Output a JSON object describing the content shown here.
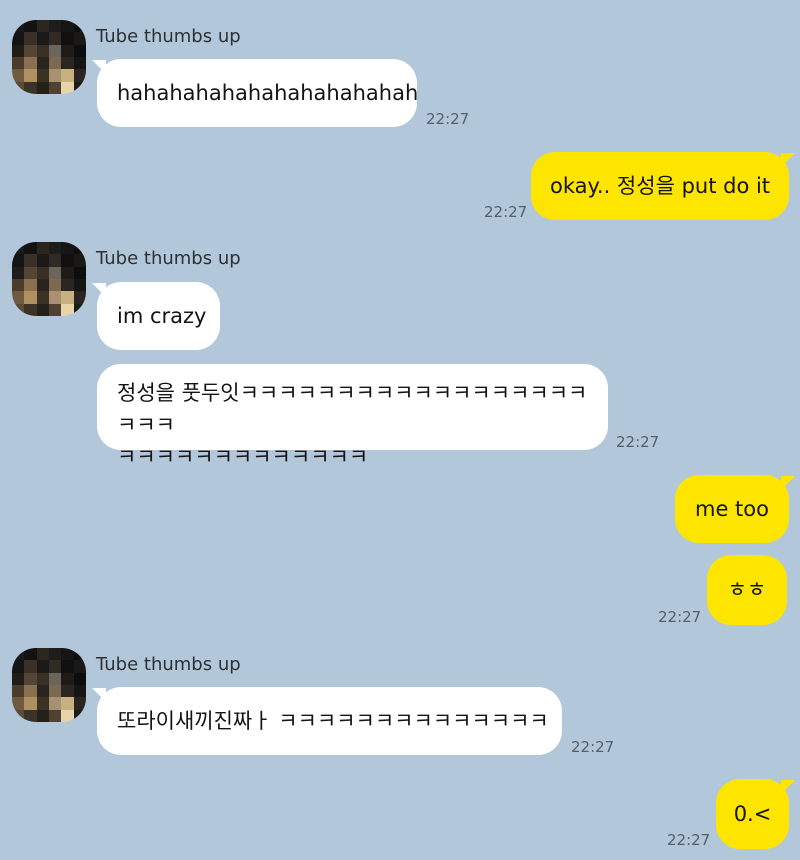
{
  "colors": {
    "background": "#b2c7da",
    "incoming_bubble": "#ffffff",
    "outgoing_bubble": "#fee500",
    "text": "#141414",
    "timestamp": "#545f69"
  },
  "sender": {
    "name": "Tube thumbs up",
    "avatar": "pixelated-avatar"
  },
  "messages": [
    {
      "direction": "incoming",
      "text": "hahahahahahahahahahahah",
      "time": "22:27"
    },
    {
      "direction": "outgoing",
      "text": "okay.. 정성을 put do it",
      "time": "22:27"
    },
    {
      "direction": "incoming",
      "text": "im crazy",
      "time": ""
    },
    {
      "direction": "incoming",
      "lines": [
        "정성을 풋두잇ㅋㅋㅋㅋㅋㅋㅋㅋㅋㅋㅋㅋㅋㅋㅋㅋㅋㅋㅋㅋㅋ",
        "ㅋㅋㅋㅋㅋㅋㅋㅋㅋㅋㅋㅋㅋ"
      ],
      "time": "22:27"
    },
    {
      "direction": "outgoing",
      "text": "me too",
      "time": ""
    },
    {
      "direction": "outgoing",
      "text": "ㅎㅎ",
      "time": "22:27"
    },
    {
      "direction": "incoming",
      "text": "또라이새끼진짜ㅏ ㅋㅋㅋㅋㅋㅋㅋㅋㅋㅋㅋㅋㅋㅋ",
      "time": "22:27"
    },
    {
      "direction": "outgoing",
      "text": "0.<",
      "time": "22:27"
    }
  ]
}
